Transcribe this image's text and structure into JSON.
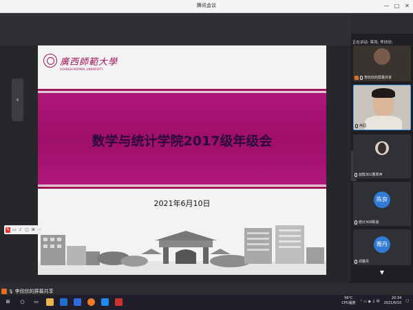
{
  "window": {
    "title": "腾讯会议",
    "controls": [
      "—",
      "□",
      "✕"
    ]
  },
  "slide": {
    "logo_cn": "廣西師範大學",
    "logo_en": "GUANGXI NORMAL UNIVERSITY",
    "title": "数学与统计学院2017级年级会",
    "date": "2021年6月10日"
  },
  "share": {
    "sharer_label": "李欣欣的屏幕共享",
    "nav_prev": "‹"
  },
  "right_panel": {
    "speaking": "正在讲话: 蒋苑; 李欣欣;",
    "tiles": [
      {
        "name": "李欣欣的屏幕共享",
        "type": "avatar-photo"
      },
      {
        "name": "冉园",
        "type": "video"
      },
      {
        "name": "叔陈301曹翠萍",
        "type": "avatar-photo"
      },
      {
        "name": "统计309陈良",
        "type": "initials",
        "initials": "陈良",
        "color": "#2f7bd6"
      },
      {
        "name": "邓雅丹",
        "type": "initials",
        "initials": "雅丹",
        "color": "#2f7bd6"
      }
    ],
    "scroll_down": "▼",
    "side_nav": "›"
  },
  "taskbar": {
    "weather_temp": "56°C",
    "weather_text": "CPU温度",
    "time": "20:34",
    "date": "2021/6/10"
  }
}
